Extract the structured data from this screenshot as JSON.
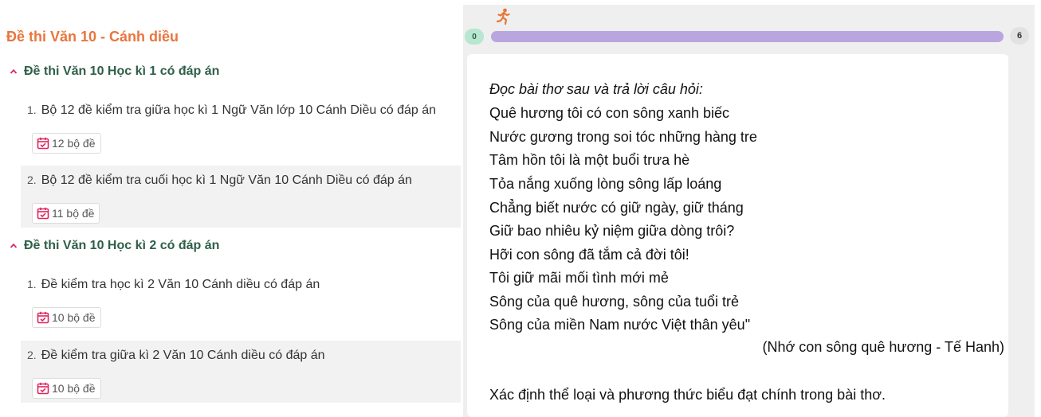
{
  "left": {
    "title": "Đề thi Văn 10 - Cánh diều",
    "sections": [
      {
        "header": "Đề thi Văn 10 Học kì 1 có đáp án",
        "items": [
          {
            "number": "1.",
            "title": "Bộ 12 đề kiểm tra giữa học kì 1 Ngữ Văn lớp 10 Cánh Diều có đáp án",
            "count": "12 bộ đề"
          },
          {
            "number": "2.",
            "title": "Bộ 12 đề kiểm tra cuối học kì 1 Ngữ Văn 10 Cánh Diều có đáp án",
            "count": "11 bộ đề"
          }
        ]
      },
      {
        "header": "Đề thi Văn 10 Học kì 2 có đáp án",
        "items": [
          {
            "number": "1.",
            "title": "Đề kiểm tra học kì 2 Văn 10 Cánh diều có đáp án",
            "count": "10 bộ đề"
          },
          {
            "number": "2.",
            "title": "Đề kiểm tra giữa kì 2 Văn 10 Cánh diều có đáp án",
            "count": "10 bộ đề"
          }
        ]
      }
    ]
  },
  "progress": {
    "start": "0",
    "end": "6"
  },
  "question": {
    "intro": "Đọc bài thơ sau và trả lời câu hỏi:",
    "poem": [
      "Quê hương tôi có con sông xanh biếc",
      "Nước gương trong soi tóc những hàng tre",
      "Tâm hồn tôi là một buổi trưa hè",
      "Tỏa nắng xuống lòng sông lấp loáng",
      "Chẳng biết nước có giữ ngày, giữ tháng",
      "Giữ bao nhiêu kỷ niệm giữa dòng trôi?",
      "Hỡi con sông đã tắm cả đời tôi!",
      "Tôi giữ mãi mối tình mới mẻ",
      "Sông của quê hương, sông của tuổi trẻ",
      "Sông của miền Nam nước Việt thân yêu\""
    ],
    "attribution": "(Nhớ con sông quê hương - Tế Hanh)",
    "prompt": "Xác định thể loại và phương thức biểu đạt chính trong bài thơ."
  },
  "colors": {
    "title": "#e8763d",
    "section_header": "#2f5f49",
    "badge_icon": "#e0245e",
    "progress_bar": "#b9a6de",
    "progress_start": "#b7e6d1",
    "runner_icon": "#e8763d"
  },
  "icons": {
    "section_toggle": "chevron-up-icon",
    "count": "calendar-check-icon",
    "runner": "running-person-icon"
  }
}
